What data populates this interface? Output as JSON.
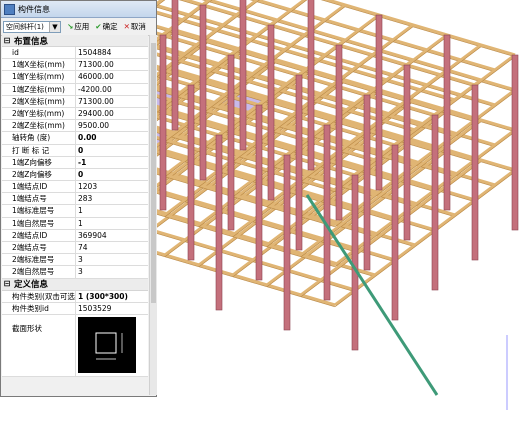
{
  "panel": {
    "title": "构件信息",
    "combo_value": "空间斜杆(1)",
    "apply_label": "应用",
    "ok_label": "确定",
    "cancel_label": "取消"
  },
  "layout_section": {
    "title": "布置信息",
    "rows": [
      {
        "key": "id",
        "value": "1504884"
      },
      {
        "key": "1端X坐标(mm)",
        "value": "71300.00"
      },
      {
        "key": "1端Y坐标(mm)",
        "value": "46000.00"
      },
      {
        "key": "1端Z坐标(mm)",
        "value": "-4200.00"
      },
      {
        "key": "2端X坐标(mm)",
        "value": "71300.00"
      },
      {
        "key": "2端Y坐标(mm)",
        "value": "29400.00"
      },
      {
        "key": "2端Z坐标(mm)",
        "value": "9500.00"
      },
      {
        "key": "轴转角 (度)",
        "value": "0.00"
      },
      {
        "key": "打 断 标 记",
        "value": "0"
      },
      {
        "key": "1端Z向偏移",
        "value": "-1"
      },
      {
        "key": "2端Z向偏移",
        "value": "0"
      },
      {
        "key": "1端结点ID",
        "value": "1203"
      },
      {
        "key": "1端结点号",
        "value": "283"
      },
      {
        "key": "1端标准层号",
        "value": "1"
      },
      {
        "key": "1端自然层号",
        "value": "1"
      },
      {
        "key": "2端结点ID",
        "value": "369904"
      },
      {
        "key": "2端结点号",
        "value": "74"
      },
      {
        "key": "2端标准层号",
        "value": "3"
      },
      {
        "key": "2端自然层号",
        "value": "3"
      }
    ]
  },
  "definition_section": {
    "title": "定义信息",
    "rows": [
      {
        "key": "构件类别(双击可选",
        "value": "1 (300*300)"
      },
      {
        "key": "构件类别id",
        "value": "1503529"
      }
    ],
    "shape_label": "截面形状"
  },
  "colors": {
    "beam": "#e0b574",
    "beam_dark": "#b98845",
    "column": "#c4707c",
    "slab": "#b6a3e3",
    "brace": "#3e9a78"
  }
}
